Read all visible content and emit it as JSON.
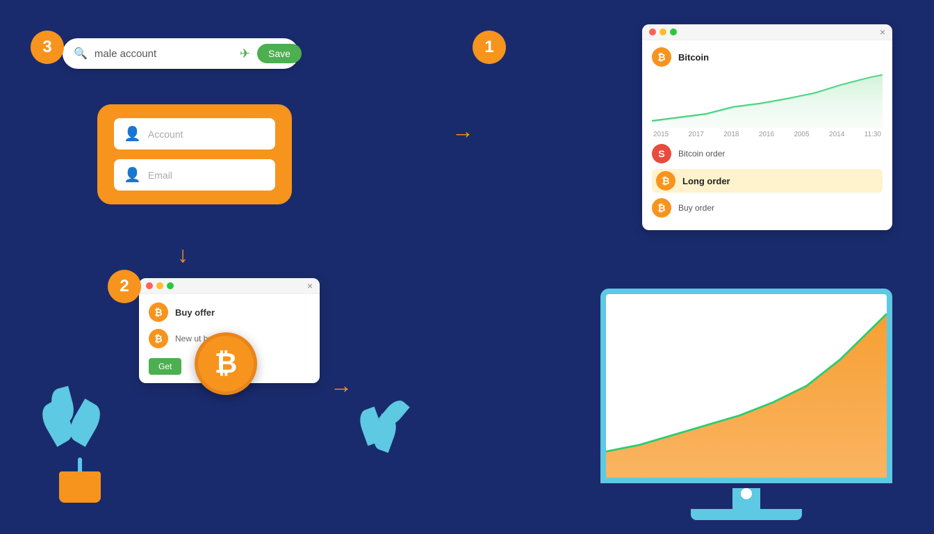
{
  "steps": {
    "step1": "1",
    "step2": "2",
    "step3": "3"
  },
  "search": {
    "placeholder": "male account",
    "save_label": "Save",
    "search_icon": "🔍",
    "send_icon": "✈"
  },
  "account_form": {
    "field1_placeholder": "Account",
    "field2_placeholder": "Email"
  },
  "buy_offer": {
    "title": "Buy offer",
    "row1_label": "Buy offer",
    "row2_label": "New ut buy order",
    "button_label": "Get",
    "close": "×"
  },
  "chart_panel": {
    "title": "Bitcoin",
    "row2_label": "Bitcoin order",
    "row3_label": "Long order",
    "row4_label": "Buy order",
    "dates": [
      "2015",
      "2017",
      "2018",
      "2016",
      "2005",
      "2014",
      "11:30"
    ],
    "close": "×"
  },
  "monitor": {
    "alt": "Growth chart monitor"
  },
  "arrows": {
    "down": "↓",
    "right": "→"
  },
  "bitcoin_symbol": "₿"
}
